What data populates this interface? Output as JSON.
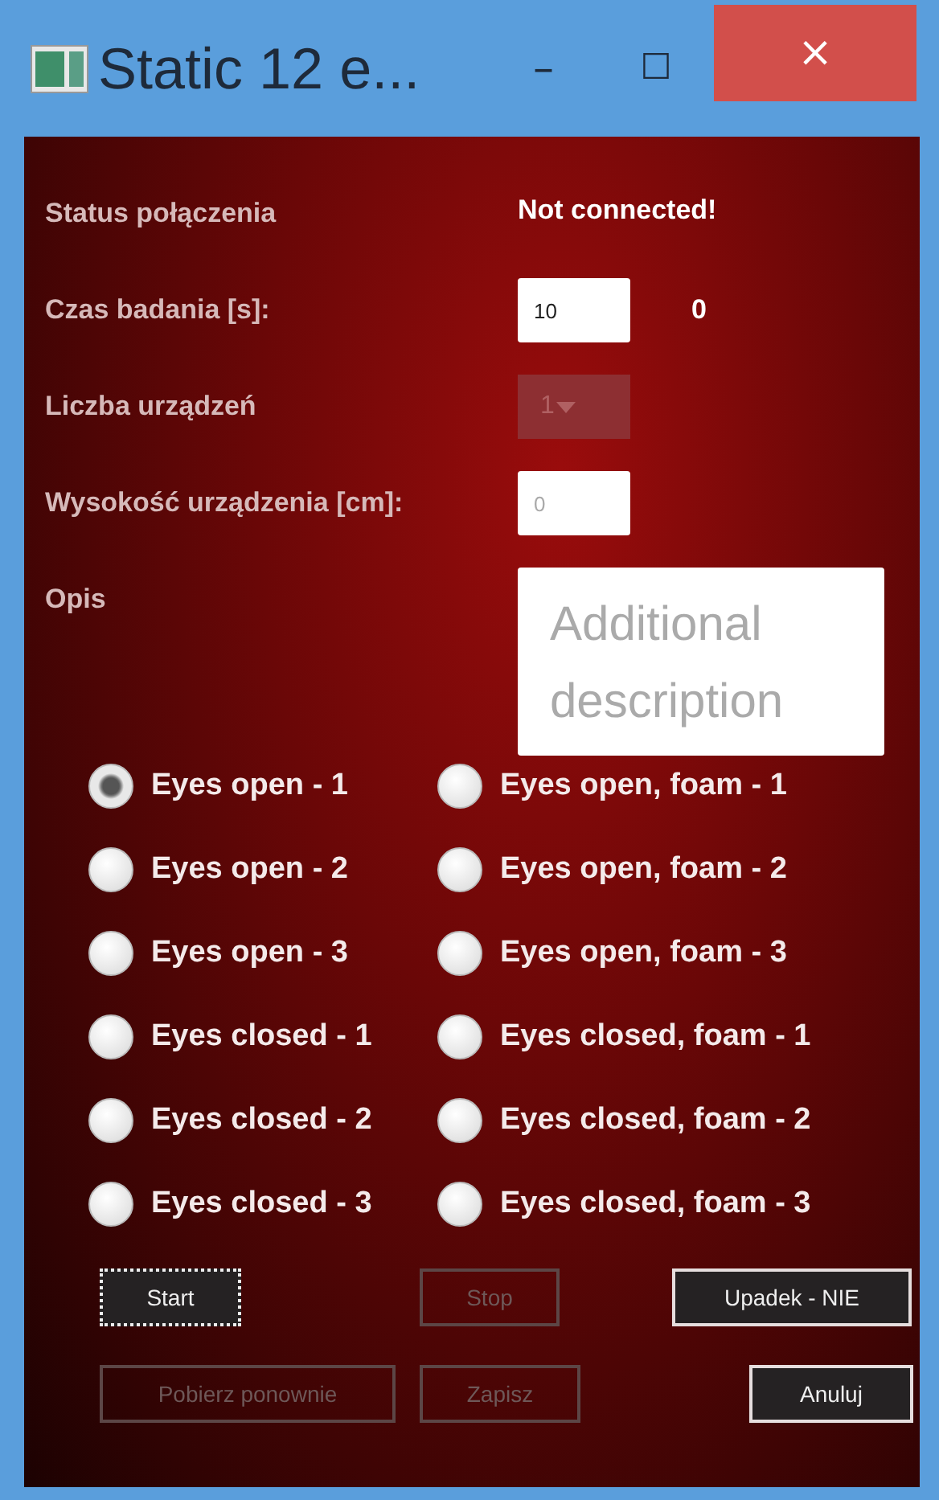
{
  "window": {
    "title": "Static 12 e..."
  },
  "title_buttons": {
    "minimize": "–",
    "maximize": "☐",
    "close": "×"
  },
  "form": {
    "status_label": "Status połączenia",
    "status_value": "Not connected!",
    "time_label": "Czas badania [s]:",
    "time_value": "10",
    "time_counter": "0",
    "devices_label": "Liczba urządzeń",
    "devices_value": "1",
    "devices_disabled": true,
    "height_label": "Wysokość urządzenia [cm]:",
    "height_placeholder": "0",
    "description_label": "Opis",
    "description_placeholder": "Additional description"
  },
  "tests": [
    {
      "label": "Eyes open - 1",
      "selected": true
    },
    {
      "label": "Eyes open, foam - 1",
      "selected": false
    },
    {
      "label": "Eyes open - 2",
      "selected": false
    },
    {
      "label": "Eyes open, foam - 2",
      "selected": false
    },
    {
      "label": "Eyes open - 3",
      "selected": false
    },
    {
      "label": "Eyes open, foam - 3",
      "selected": false
    },
    {
      "label": "Eyes closed - 1",
      "selected": false
    },
    {
      "label": "Eyes closed, foam - 1",
      "selected": false
    },
    {
      "label": "Eyes closed - 2",
      "selected": false
    },
    {
      "label": "Eyes closed, foam - 2",
      "selected": false
    },
    {
      "label": "Eyes closed - 3",
      "selected": false
    },
    {
      "label": "Eyes closed, foam - 3",
      "selected": false
    }
  ],
  "buttons": [
    {
      "label": "Start",
      "disabled": false,
      "focused": true
    },
    {
      "label": "Stop",
      "disabled": true,
      "focused": false
    },
    {
      "label": "Upadek - NIE",
      "disabled": false,
      "focused": false
    },
    {
      "label": "Pobierz ponownie",
      "disabled": true,
      "focused": false
    },
    {
      "label": "Zapisz",
      "disabled": true,
      "focused": false
    },
    {
      "label": "Anuluj",
      "disabled": false,
      "focused": false
    }
  ]
}
